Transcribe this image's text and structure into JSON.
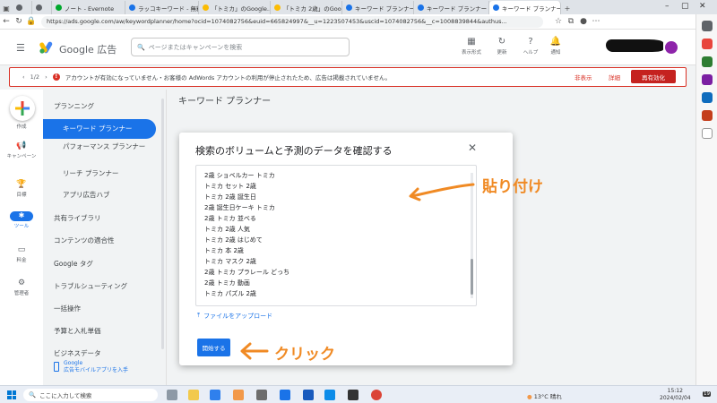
{
  "browser": {
    "tabs": [
      {
        "label": "",
        "color": "#5f6368"
      },
      {
        "label": "",
        "color": "#5f6368"
      },
      {
        "label": "ノート - Evernote",
        "color": "#00a82d"
      },
      {
        "label": "ラッコキーワード - 無料",
        "color": "#1a73e8"
      },
      {
        "label": "「トミカ」のGoogle…",
        "color": "#fbbc04"
      },
      {
        "label": "「トミカ 2歳」のGoogle",
        "color": "#fbbc04"
      },
      {
        "label": "キーワード プランナー",
        "color": "#1a73e8"
      },
      {
        "label": "キーワード プランナー",
        "color": "#1a73e8"
      },
      {
        "label": "キーワード プランナー",
        "color": "#1a73e8"
      }
    ],
    "url": "https://ads.google.com/aw/keywordplanner/home?ocid=1074082756&euid=665824997&__u=1223507453&uscid=1074082756&__c=1008839844&authus..."
  },
  "header": {
    "brand": "Google 広告",
    "search_placeholder": "ページまたはキャンペーンを検索",
    "icons": [
      {
        "label": "表示形式",
        "icon": "display-format-icon"
      },
      {
        "label": "更新",
        "icon": "refresh-icon"
      },
      {
        "label": "ヘルプ",
        "icon": "help-icon"
      },
      {
        "label": "通知",
        "icon": "bell-icon"
      }
    ]
  },
  "alert": {
    "page": "1/2",
    "message": "アカウントが有効になっていません・お客様の AdWords アカウントの利用が停止されたため、広告は掲載されていません。",
    "dismiss": "非表示",
    "detail": "詳細",
    "action": "再有効化",
    "color": "#d93025"
  },
  "rail": {
    "items": [
      {
        "label": "作成"
      },
      {
        "label": "キャンペーン"
      },
      {
        "label": "目標"
      },
      {
        "label": "ツール"
      },
      {
        "label": "料金"
      },
      {
        "label": "管理者"
      }
    ]
  },
  "subnav": {
    "items": [
      {
        "label": "プランニング"
      },
      {
        "label": "キーワード プランナー"
      },
      {
        "label": "パフォーマンス プランナー"
      },
      {
        "label": "リーチ プランナー"
      },
      {
        "label": "アプリ広告ハブ"
      },
      {
        "label": "共有ライブラリ"
      },
      {
        "label": "コンテンツの適合性"
      },
      {
        "label": "Google タグ"
      },
      {
        "label": "トラブルシューティング"
      },
      {
        "label": "一括操作"
      },
      {
        "label": "予算と入札単価"
      },
      {
        "label": "ビジネスデータ"
      }
    ],
    "promo_line1": "Google",
    "promo_line2": "広告モバイルアプリを入手"
  },
  "main": {
    "title": "キーワード プランナー",
    "dialog": {
      "title": "検索のボリュームと予測のデータを確認する",
      "keywords": [
        "2歳 ショベルカー トミカ",
        "トミカ セット 2歳",
        "トミカ 2歳 誕生日",
        "2歳 誕生日ケーキ トミカ",
        "2歳 トミカ 並べる",
        "トミカ 2歳 人気",
        "トミカ 2歳 はじめて",
        "トミカ 本 2歳",
        "トミカ マスク 2歳",
        "2歳 トミカ プラレール どっち",
        "2歳 トミカ 動画",
        "トミカ パズル 2歳"
      ],
      "upload_label": "ファイルをアップロード",
      "start_label": "開始する"
    }
  },
  "annotations": {
    "paste": "貼り付け",
    "click": "クリック",
    "color": "#f08a24"
  },
  "taskbar": {
    "search_placeholder": "ここに入力して検索",
    "weather": "13°C 晴れ",
    "time": "15:12",
    "date": "2024/02/04",
    "notification_count": "19"
  }
}
